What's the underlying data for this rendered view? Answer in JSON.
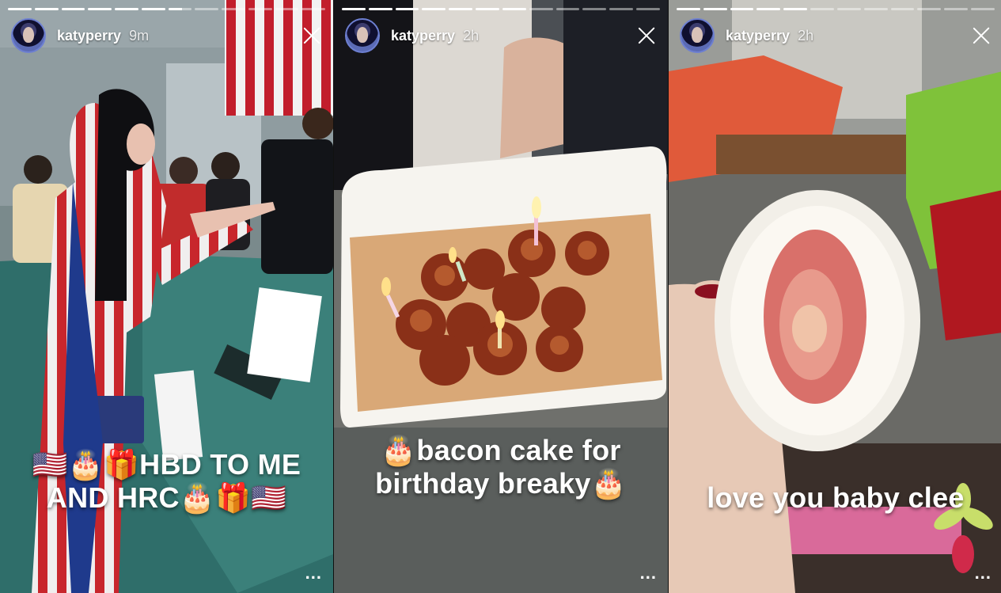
{
  "stories": [
    {
      "username": "katyperry",
      "time": "9m",
      "caption_line1": "🇺🇸🎂🎁HBD TO ME",
      "caption_line2": "AND HRC🎂🎁🇺🇸",
      "progress": [
        1,
        1,
        1,
        1,
        1,
        1,
        0.6,
        0,
        0,
        0,
        0,
        0
      ]
    },
    {
      "username": "katyperry",
      "time": "2h",
      "caption_line1": "🎂bacon cake for",
      "caption_line2": "birthday breaky🎂",
      "progress": [
        1,
        1,
        1,
        1,
        1,
        1,
        1,
        0,
        0,
        0,
        0,
        0
      ]
    },
    {
      "username": "katyperry",
      "time": "2h",
      "caption_line1": "love you baby clee",
      "caption_line2": "",
      "progress": [
        1,
        1,
        1,
        1,
        1,
        0,
        0,
        0,
        0,
        0,
        0,
        0
      ]
    }
  ],
  "icons": {
    "close": "close-icon",
    "more": "more-options-icon"
  },
  "colors": {
    "text": "#ffffff",
    "progress_active": "#ffffff",
    "progress_inactive": "rgba(255,255,255,0.45)"
  }
}
